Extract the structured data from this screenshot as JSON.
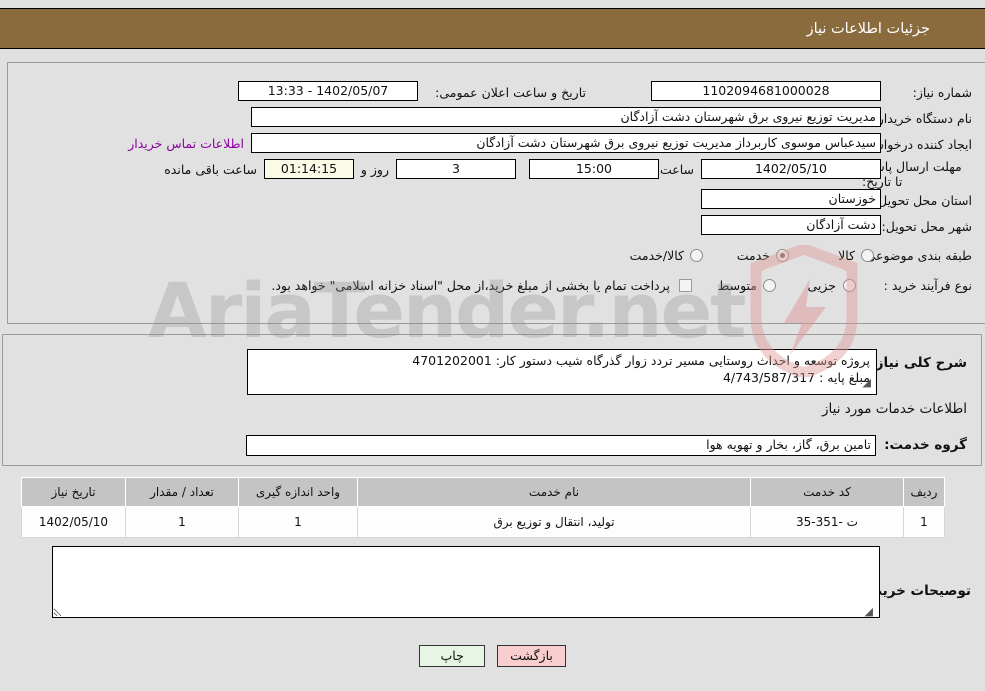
{
  "header": {
    "title": "جزئیات اطلاعات نیاز",
    "bar_color": "#8a6b3e"
  },
  "watermark": {
    "text": "AriaTender.net"
  },
  "details": {
    "need_number_label": "شماره نیاز:",
    "need_number_value": "1102094681000028",
    "announce_label": "تاریخ و ساعت اعلان عمومی:",
    "announce_value": "1402/05/07 - 13:33",
    "buyer_org_label": "نام دستگاه خریدار:",
    "buyer_org_value": "مدیریت توزیع نیروی برق شهرستان دشت آزادگان",
    "requester_label": "ایجاد کننده درخواست:",
    "requester_value": "سیدعباس موسوی کاربرداز مدیریت توزیع نیروی برق شهرستان دشت آزادگان",
    "contact_link": "اطلاعات تماس خریدار",
    "deadline_label": "مهلت ارسال پاسخ: تا تاریخ:",
    "deadline_date": "1402/05/10",
    "hour_label": "ساعت",
    "deadline_time": "15:00",
    "days_remaining": "3",
    "days_label": "روز و",
    "countdown": "01:14:15",
    "countdown_label": "ساعت باقی مانده",
    "province_label": "استان محل تحویل:",
    "province_value": "خوزستان",
    "city_label": "شهر محل تحویل:",
    "city_value": "دشت آزادگان",
    "category_label": "طبقه بندی موضوعی:",
    "category_options": [
      "کالا",
      "خدمت",
      "کالا/خدمت"
    ],
    "category_selected": "خدمت",
    "process_label": "نوع فرآیند خرید :",
    "process_options": [
      "جزیی",
      "متوسط"
    ],
    "process_selected": "",
    "treasury_checkbox_label": "پرداخت تمام یا بخشی از مبلغ خرید،از محل \"اسناد خزانه اسلامی\" خواهد بود.",
    "treasury_checked": false
  },
  "description": {
    "label": "شرح کلی نیاز;",
    "value": "پروژه توسعه و احداث روستایی مسیر تردد زوار گذرگاه شیب دستور کار: 4701202001\nمبلغ پایه : 4/743/587/317",
    "section_heading": "اطلاعات خدمات مورد نیاز",
    "service_group_label": "گروه خدمت:",
    "service_group_value": "تامین برق، گاز، بخار و تهویه هوا"
  },
  "table": {
    "columns": [
      "ردیف",
      "کد خدمت",
      "نام خدمت",
      "واحد اندازه گیری",
      "تعداد / مقدار",
      "تاریخ نیاز"
    ],
    "rows": [
      {
        "radif": "1",
        "code": "ت -351-35",
        "name": "تولید، انتقال و توزیع برق",
        "unit": "1",
        "qty": "1",
        "date": "1402/05/10"
      }
    ]
  },
  "notes": {
    "label": "توصیحات خریدار;",
    "value": ""
  },
  "footer": {
    "print_label": "چاپ",
    "back_label": "بازگشت"
  }
}
